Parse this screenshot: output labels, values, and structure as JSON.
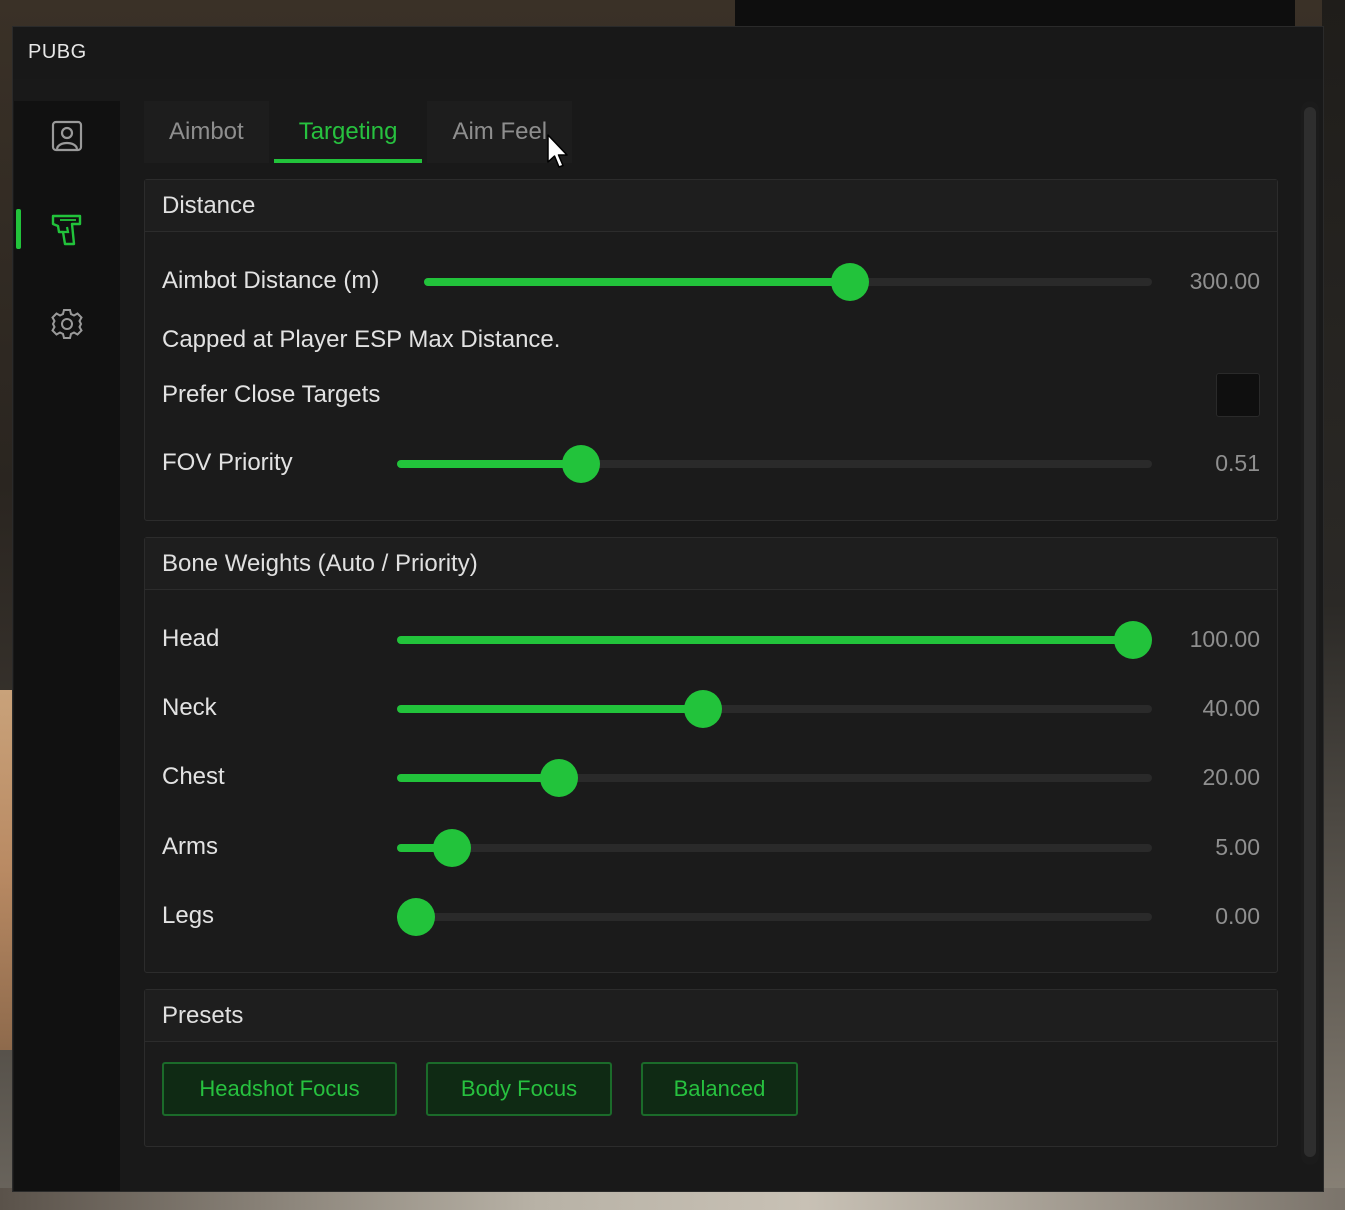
{
  "window": {
    "title": "PUBG"
  },
  "sidebar": {
    "items": [
      {
        "icon": "user-icon",
        "active": false
      },
      {
        "icon": "gun-icon",
        "active": true
      },
      {
        "icon": "gear-icon",
        "active": false
      }
    ]
  },
  "tabs": [
    {
      "label": "Aimbot",
      "active": false
    },
    {
      "label": "Targeting",
      "active": true
    },
    {
      "label": "Aim Feel",
      "active": false
    }
  ],
  "distance": {
    "header": "Distance",
    "aimbot_distance": {
      "label": "Aimbot Distance (m)",
      "value": "300.00",
      "fraction": 0.59
    },
    "note": "Capped at Player ESP Max Distance.",
    "prefer_close": {
      "label": "Prefer Close Targets",
      "checked": false
    },
    "fov_priority": {
      "label": "FOV Priority",
      "value": "0.51",
      "fraction": 0.23
    }
  },
  "bones": {
    "header": "Bone Weights (Auto / Priority)",
    "items": [
      {
        "label": "Head",
        "value": "100.00",
        "fraction": 1.0
      },
      {
        "label": "Neck",
        "value": "40.00",
        "fraction": 0.4
      },
      {
        "label": "Chest",
        "value": "20.00",
        "fraction": 0.2
      },
      {
        "label": "Arms",
        "value": "5.00",
        "fraction": 0.05
      },
      {
        "label": "Legs",
        "value": "0.00",
        "fraction": 0.0
      }
    ]
  },
  "presets": {
    "header": "Presets",
    "buttons": [
      "Headshot Focus",
      "Body Focus",
      "Balanced"
    ]
  },
  "colors": {
    "accent": "#22c33b",
    "panel": "#1b1b1b",
    "sidebar": "#111111"
  }
}
